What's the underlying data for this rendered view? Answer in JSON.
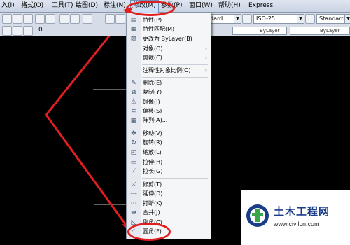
{
  "menubar": {
    "items": [
      "入(I)",
      "格式(O)",
      "工具(T)",
      "绘图(D)",
      "标注(N)",
      "修改(M)",
      "参数(P)",
      "窗口(W)",
      "帮助(H)",
      "Express"
    ]
  },
  "toolbar": {
    "dimstyle": "ISO-25",
    "textstyle": "Standard",
    "tablestyle_partial": "dard",
    "layer": "0",
    "linetype1": "ByLayer",
    "linetype2": "ByLayer"
  },
  "modify_menu": {
    "items": [
      {
        "label": "特性(P)",
        "icon": "properties-icon"
      },
      {
        "label": "特性匹配(M)",
        "icon": "match-properties-icon"
      },
      {
        "label": "更改为 ByLayer(B)",
        "icon": "change-bylayer-icon"
      },
      {
        "label": "对象(O)",
        "sub": "›"
      },
      {
        "label": "剪裁(C)",
        "sub": "›"
      },
      {
        "label": "注释性对象比例(O)",
        "sub": "›"
      },
      {
        "label": "删除(E)",
        "icon": "erase-icon"
      },
      {
        "label": "复制(Y)",
        "icon": "copy-icon"
      },
      {
        "label": "镜像(I)",
        "icon": "mirror-icon"
      },
      {
        "label": "偏移(S)",
        "icon": "offset-icon"
      },
      {
        "label": "阵列(A)...",
        "icon": "array-icon"
      },
      {
        "label": "移动(V)",
        "icon": "move-icon"
      },
      {
        "label": "旋转(R)",
        "icon": "rotate-icon"
      },
      {
        "label": "缩放(L)",
        "icon": "scale-icon"
      },
      {
        "label": "拉伸(H)",
        "icon": "stretch-icon"
      },
      {
        "label": "拉长(G)",
        "icon": "lengthen-icon"
      },
      {
        "label": "修剪(T)",
        "icon": "trim-icon"
      },
      {
        "label": "延伸(D)",
        "icon": "extend-icon"
      },
      {
        "label": "打断(K)",
        "icon": "break-icon"
      },
      {
        "label": "合并(J)",
        "icon": "join-icon"
      },
      {
        "label": "倒角(C)",
        "icon": "chamfer-icon"
      },
      {
        "label": "圆角(F)",
        "icon": "fillet-icon"
      }
    ]
  },
  "watermark": {
    "title": "土木工程网",
    "url": "www.civilcn.com"
  },
  "colors": {
    "canvas": "#000000",
    "highlight": "#e02020",
    "watermark_text": "#1a3d8a"
  }
}
